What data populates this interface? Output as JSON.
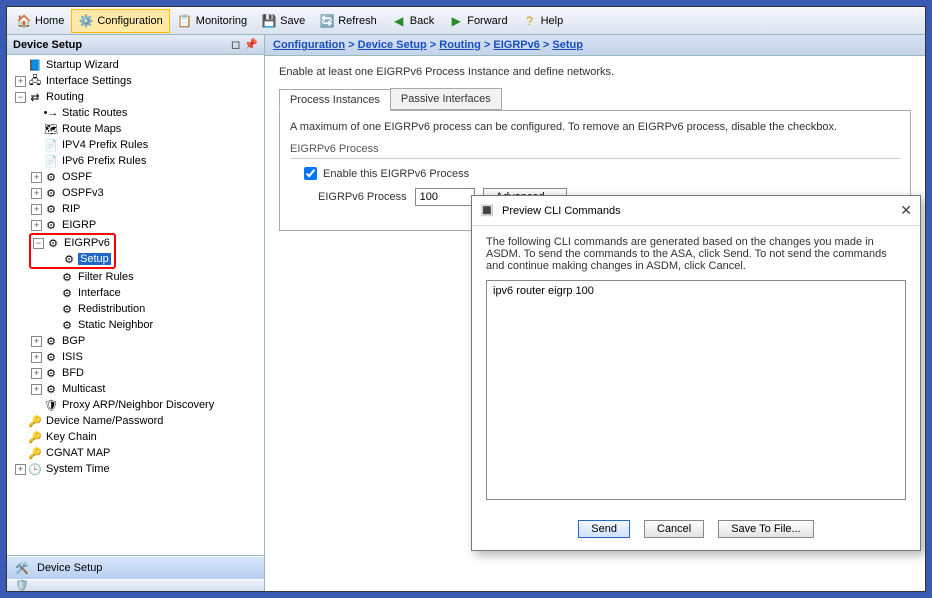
{
  "toolbar": {
    "home": "Home",
    "configuration": "Configuration",
    "monitoring": "Monitoring",
    "save": "Save",
    "refresh": "Refresh",
    "back": "Back",
    "forward": "Forward",
    "help": "Help"
  },
  "leftPanel": {
    "title": "Device Setup"
  },
  "tree": {
    "startup": "Startup Wizard",
    "interface": "Interface Settings",
    "routing": "Routing",
    "static": "Static Routes",
    "routemaps": "Route Maps",
    "ipv4prefix": "IPV4 Prefix Rules",
    "ipv6prefix": "IPv6 Prefix Rules",
    "ospf": "OSPF",
    "ospfv3": "OSPFv3",
    "rip": "RIP",
    "eigrp": "EIGRP",
    "eigrpv6": "EIGRPv6",
    "setup": "Setup",
    "filter": "Filter Rules",
    "iface": "Interface",
    "redist": "Redistribution",
    "sneigh": "Static Neighbor",
    "bgp": "BGP",
    "isis": "ISIS",
    "bfd": "BFD",
    "multicast": "Multicast",
    "proxy": "Proxy ARP/Neighbor Discovery",
    "devnp": "Device Name/Password",
    "keychain": "Key Chain",
    "cgnat": "CGNAT MAP",
    "systime": "System Time"
  },
  "bottomNav": {
    "deviceSetup": "Device Setup"
  },
  "breadcrumb": {
    "a": "Configuration",
    "b": "Device Setup",
    "c": "Routing",
    "d": "EIGRPv6",
    "e": "Setup"
  },
  "content": {
    "intro": "Enable at least one EIGRPv6 Process Instance and define networks.",
    "tab1": "Process Instances",
    "tab2": "Passive Interfaces",
    "maxnote": "A maximum of one EIGRPv6 process can be configured. To remove an EIGRPv6 process, disable the checkbox.",
    "grouplabel": "EIGRPv6 Process",
    "chk": "Enable this EIGRPv6 Process",
    "proclabel": "EIGRPv6 Process",
    "procval": "100",
    "adv": "Advanced..."
  },
  "dialog": {
    "title": "Preview CLI Commands",
    "msg": "The following CLI commands are generated based on the changes you made in ASDM. To send the commands to the ASA, click Send. To not send the commands and continue making changes in ASDM, click Cancel.",
    "cmd": "ipv6 router eigrp 100",
    "send": "Send",
    "cancel": "Cancel",
    "save": "Save To File..."
  }
}
